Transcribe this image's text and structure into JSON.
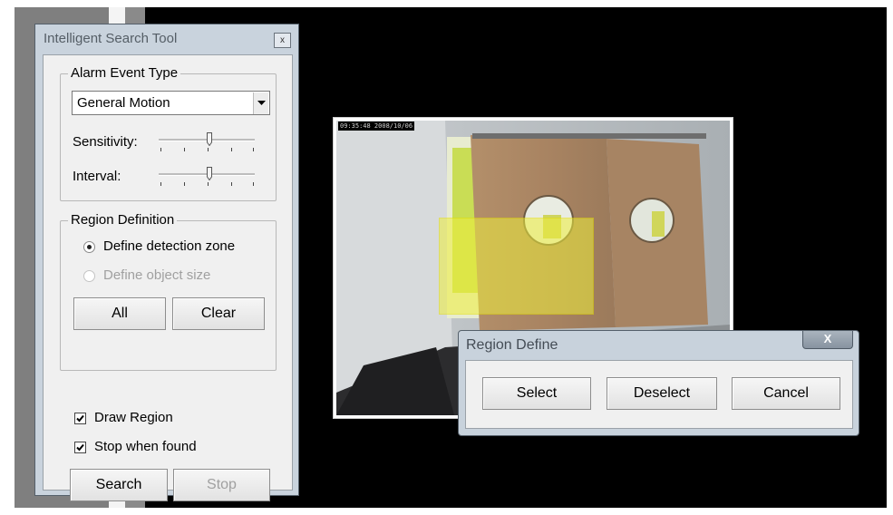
{
  "tool_window": {
    "title": "Intelligent Search Tool",
    "close_label": "x",
    "alarm_group": {
      "legend": "Alarm Event Type",
      "event_type_value": "General Motion",
      "sensitivity_label": "Sensitivity:",
      "sensitivity_level": 0.55,
      "interval_label": "Interval:",
      "interval_level": 0.55
    },
    "region_group": {
      "legend": "Region Definition",
      "option_zone": "Define detection zone",
      "option_zone_selected": true,
      "option_size": "Define object size",
      "option_size_enabled": false,
      "all_label": "All",
      "clear_label": "Clear"
    },
    "draw_region_label": "Draw Region",
    "draw_region_checked": true,
    "stop_when_found_label": "Stop when found",
    "stop_when_found_checked": true,
    "search_label": "Search",
    "stop_label": "Stop",
    "stop_enabled": false
  },
  "camera": {
    "timestamp": "09:35:48 2008/10/06",
    "selection_color": "#eeee3c"
  },
  "region_define": {
    "title": "Region Define",
    "close_label": "X",
    "select_label": "Select",
    "deselect_label": "Deselect",
    "cancel_label": "Cancel"
  }
}
